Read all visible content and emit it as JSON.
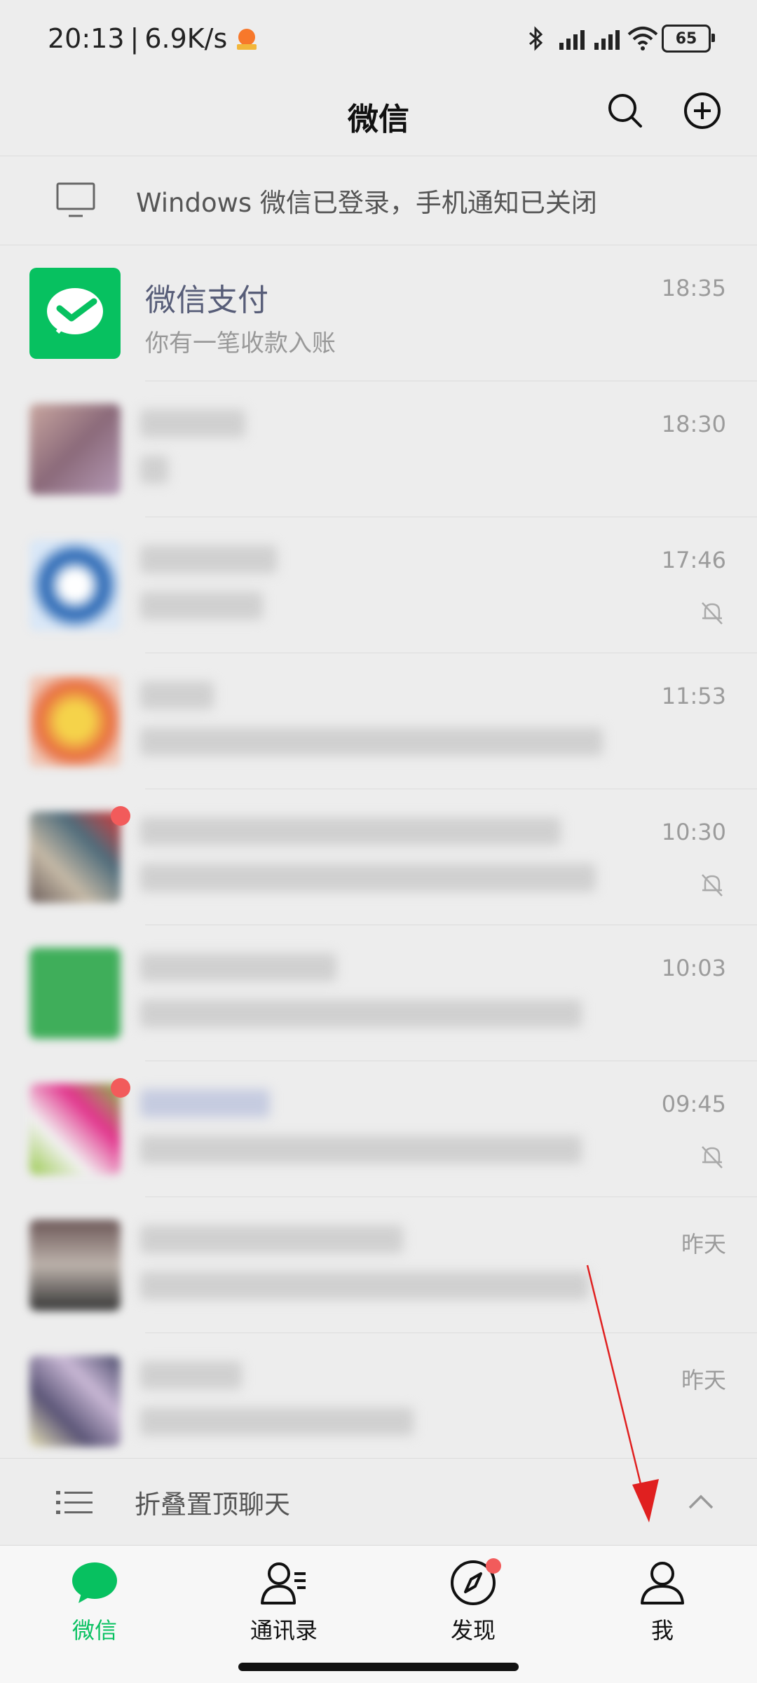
{
  "status_bar": {
    "time": "20:13",
    "speed": "6.9K/s",
    "battery": "65"
  },
  "header": {
    "title": "微信"
  },
  "banner": {
    "text": "Windows 微信已登录，手机通知已关闭"
  },
  "pinned_chat": {
    "name": "微信支付",
    "preview": "你有一笔收款入账",
    "time": "18:35"
  },
  "chats": [
    {
      "time": "18:30",
      "muted": false
    },
    {
      "time": "17:46",
      "muted": true
    },
    {
      "time": "11:53",
      "muted": false
    },
    {
      "time": "10:30",
      "muted": true
    },
    {
      "time": "10:03",
      "muted": false
    },
    {
      "time": "09:45",
      "muted": true
    },
    {
      "time": "昨天",
      "muted": false
    },
    {
      "time": "昨天",
      "muted": false
    }
  ],
  "fold_label": "折叠置顶聊天",
  "tabs": [
    {
      "label": "微信"
    },
    {
      "label": "通讯录"
    },
    {
      "label": "发现"
    },
    {
      "label": "我"
    }
  ],
  "colors": {
    "brand_green": "#07c160",
    "badge_red": "#f25b5b"
  }
}
